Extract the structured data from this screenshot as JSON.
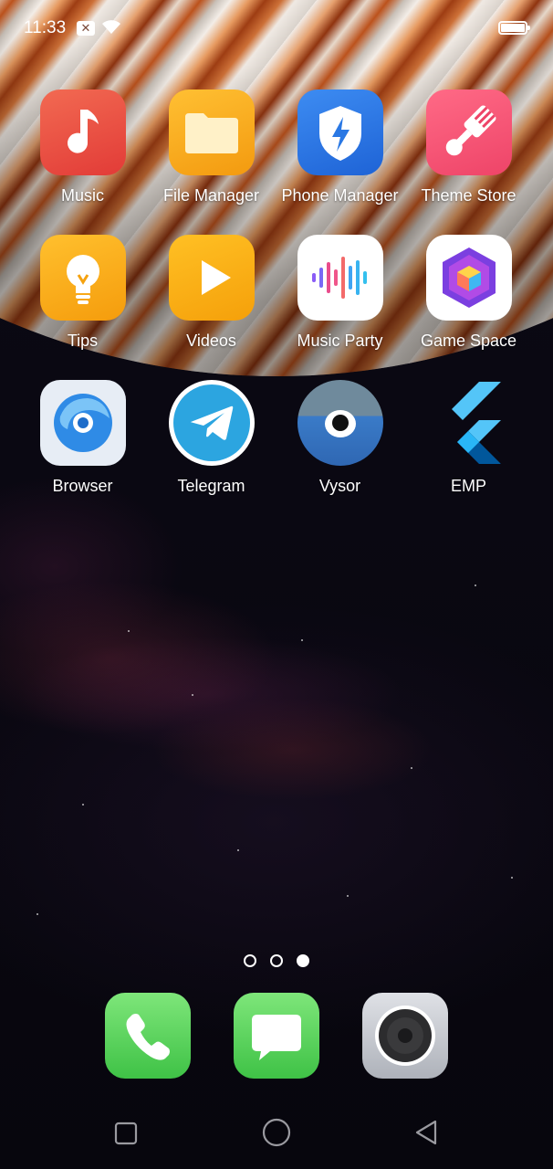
{
  "status_bar": {
    "time": "11:33",
    "notification_icon": "x-notification-icon",
    "signal": "wifi-icon",
    "battery": "battery-icon"
  },
  "apps": [
    {
      "label": "Music",
      "icon": "music-note-icon",
      "color": "#e8473e"
    },
    {
      "label": "File Manager",
      "icon": "folder-icon",
      "color": "#f6a21a"
    },
    {
      "label": "Phone Manager",
      "icon": "shield-bolt-icon",
      "color": "#2a78e4"
    },
    {
      "label": "Theme Store",
      "icon": "paintbrush-icon",
      "color": "#f25474"
    },
    {
      "label": "Tips",
      "icon": "lightbulb-icon",
      "color": "#f7ae1c"
    },
    {
      "label": "Videos",
      "icon": "play-icon",
      "color": "#f9ad12"
    },
    {
      "label": "Music Party",
      "icon": "sound-wave-icon",
      "color": "#ffffff"
    },
    {
      "label": "Game Space",
      "icon": "game-cube-icon",
      "color": "#ffffff"
    },
    {
      "label": "Browser",
      "icon": "browser-swirl-icon",
      "color": "#e9eef5"
    },
    {
      "label": "Telegram",
      "icon": "paper-plane-icon",
      "color": "#2ca5e0"
    },
    {
      "label": "Vysor",
      "icon": "eye-icon",
      "color": "#3a7bc8"
    },
    {
      "label": "EMP",
      "icon": "flutter-icon",
      "color": "#3ea6f2"
    }
  ],
  "page_indicator": {
    "pages": 3,
    "current": 3
  },
  "dock": [
    {
      "name": "Phone",
      "icon": "phone-icon",
      "color": "#5fd35d"
    },
    {
      "name": "Messages",
      "icon": "message-bubble-icon",
      "color": "#5fd35d"
    },
    {
      "name": "Camera",
      "icon": "camera-lens-icon",
      "color": "#c8cbd1"
    }
  ],
  "nav_bar": {
    "recents": "square-icon",
    "home": "circle-icon",
    "back": "triangle-back-icon"
  }
}
